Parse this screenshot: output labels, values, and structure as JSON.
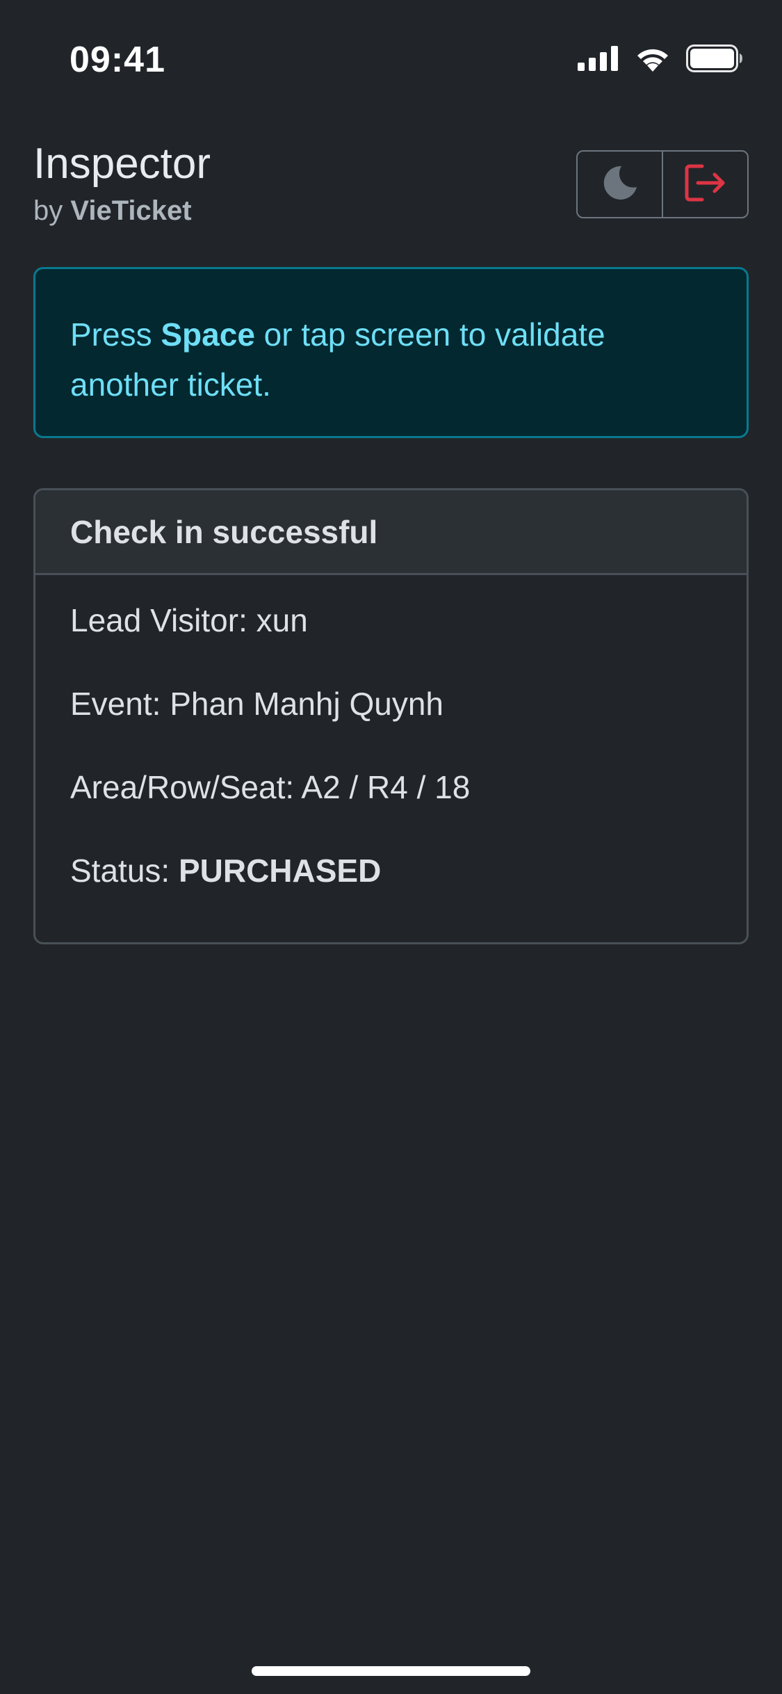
{
  "status_bar": {
    "time": "09:41",
    "icons": [
      "cellular-signal-icon",
      "wifi-icon",
      "battery-icon"
    ]
  },
  "header": {
    "title": "Inspector",
    "subtitle_prefix": "by",
    "subtitle_brand": "VieTicket",
    "theme_toggle_icon": "moon-icon",
    "logout_icon": "logout-icon"
  },
  "alert": {
    "text_before": "Press ",
    "key": "Space",
    "text_after": " or tap screen to validate another ticket."
  },
  "result_card": {
    "title": "Check in successful",
    "lead_visitor_label": "Lead Visitor: ",
    "lead_visitor_value": "xun",
    "event_label": "Event: ",
    "event_value": "Phan Manhj Quynh",
    "seat_label": "Area/Row/Seat: ",
    "seat_value": "A2 / R4 / 18",
    "status_label": "Status: ",
    "status_value": "PURCHASED"
  },
  "colors": {
    "background": "#212529",
    "alert_bg": "#032830",
    "alert_border": "#087990",
    "alert_text": "#6edff6",
    "logout_red": "#dc3545",
    "moon_gray": "#6c757d"
  }
}
